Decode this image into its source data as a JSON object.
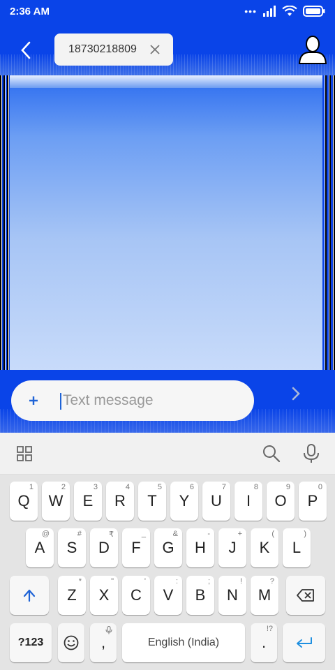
{
  "status_bar": {
    "time": "2:36 AM",
    "more_dots": "•••"
  },
  "header": {
    "recipient": "18730218809"
  },
  "compose": {
    "placeholder": "Text message"
  },
  "keyboard": {
    "row1": [
      {
        "label": "Q",
        "hint": "1"
      },
      {
        "label": "W",
        "hint": "2"
      },
      {
        "label": "E",
        "hint": "3"
      },
      {
        "label": "R",
        "hint": "4"
      },
      {
        "label": "T",
        "hint": "5"
      },
      {
        "label": "Y",
        "hint": "6"
      },
      {
        "label": "U",
        "hint": "7"
      },
      {
        "label": "I",
        "hint": "8"
      },
      {
        "label": "O",
        "hint": "9"
      },
      {
        "label": "P",
        "hint": "0"
      }
    ],
    "row2": [
      {
        "label": "A",
        "hint": "@"
      },
      {
        "label": "S",
        "hint": "#"
      },
      {
        "label": "D",
        "hint": "₹"
      },
      {
        "label": "F",
        "hint": "_"
      },
      {
        "label": "G",
        "hint": "&"
      },
      {
        "label": "H",
        "hint": "-"
      },
      {
        "label": "J",
        "hint": "+"
      },
      {
        "label": "K",
        "hint": "("
      },
      {
        "label": "L",
        "hint": ")"
      }
    ],
    "row3": [
      {
        "label": "Z",
        "hint": "*"
      },
      {
        "label": "X",
        "hint": "\""
      },
      {
        "label": "C",
        "hint": "'"
      },
      {
        "label": "V",
        "hint": ":"
      },
      {
        "label": "B",
        "hint": ";"
      },
      {
        "label": "N",
        "hint": "!"
      },
      {
        "label": "M",
        "hint": "?"
      }
    ],
    "symbols_label": "?123",
    "comma_label": ",",
    "space_label": "English (India)",
    "period_label": ".",
    "period_hint": "!?"
  },
  "colors": {
    "primary": "#0a44e8",
    "accent": "#1e63d6"
  }
}
